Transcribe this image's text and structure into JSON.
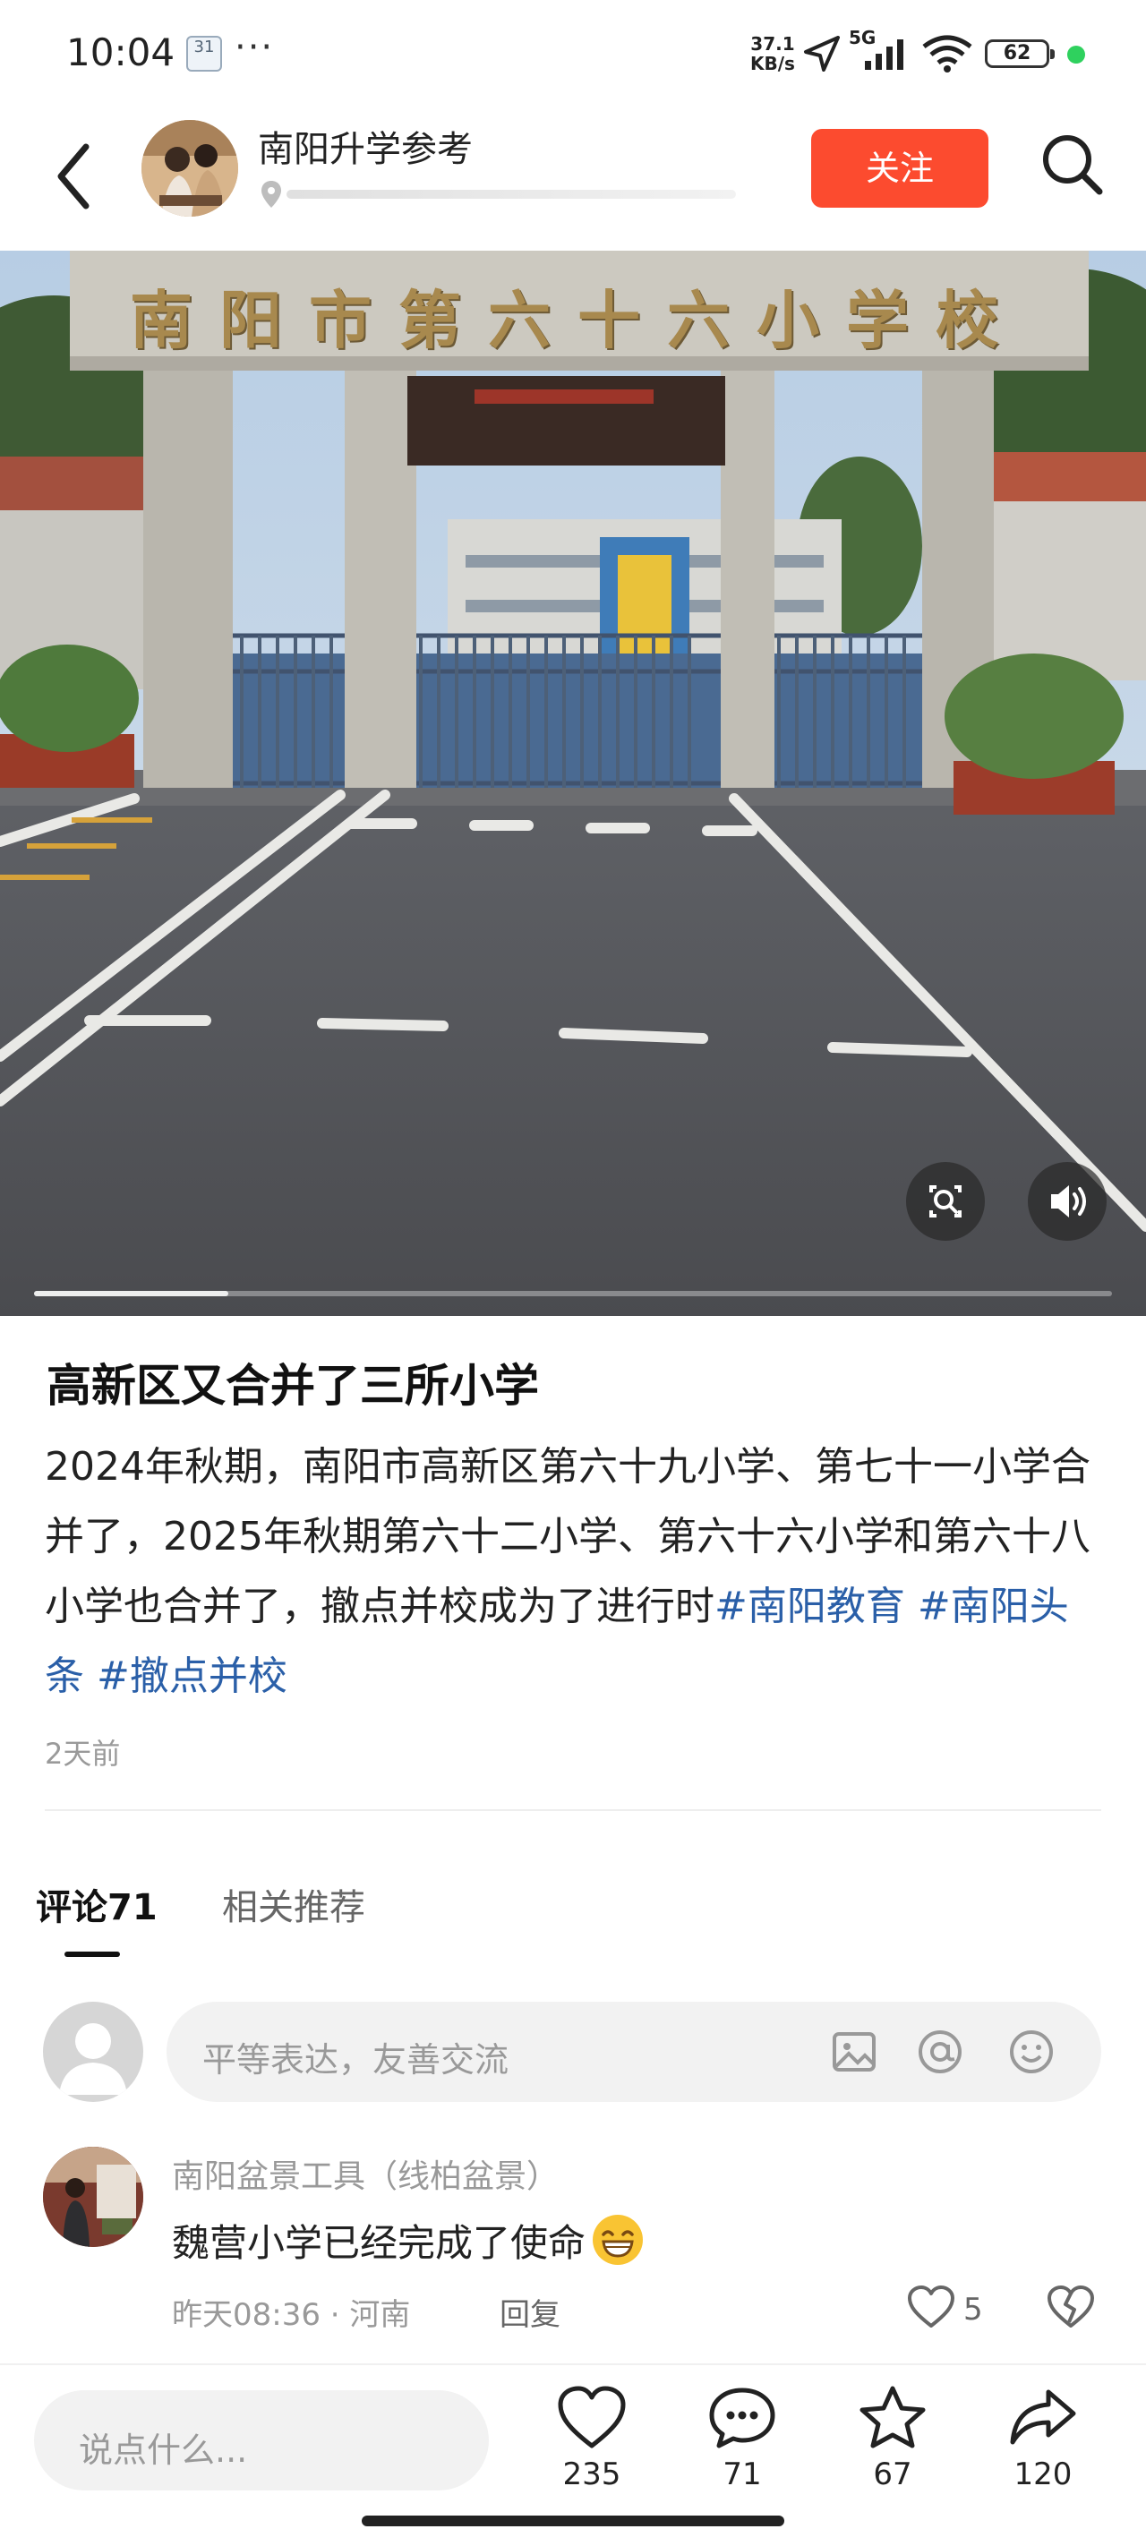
{
  "status_bar": {
    "time": "10:04",
    "calendar_day": "31",
    "more": "···",
    "net_speed_value": "37.1",
    "net_speed_unit": "KB/s",
    "network": "5G",
    "battery": "62"
  },
  "header": {
    "account_name": "南阳升学参考",
    "follow_label": "关注",
    "accent_color": "#fc4b2f"
  },
  "media": {
    "school_sign": "南阳市第六十六小学校",
    "video_progress_percent": 18
  },
  "post": {
    "title": "高新区又合并了三所小学",
    "body": "2024年秋期，南阳市高新区第六十九小学、第七十一小学合并了，2025年秋期第六十二小学、第六十六小学和第六十八小学也合并了，撤点并校成为了进行时",
    "hashtags": [
      "#南阳教育",
      "#南阳头条",
      "#撤点并校"
    ],
    "time_ago": "2天前"
  },
  "tabs": {
    "comments_label": "评论71",
    "related_label": "相关推荐"
  },
  "comment_input": {
    "placeholder": "平等表达，友善交流"
  },
  "comments": [
    {
      "user": "南阳盆景工具（线柏盆景）",
      "text": "魏营小学已经完成了使命",
      "time": "昨天08:36",
      "separator": "·",
      "location": "河南",
      "reply_label": "回复",
      "likes": "5"
    }
  ],
  "bottom_bar": {
    "placeholder": "说点什么...",
    "likes": "235",
    "comments": "71",
    "favorites": "67",
    "shares": "120"
  }
}
